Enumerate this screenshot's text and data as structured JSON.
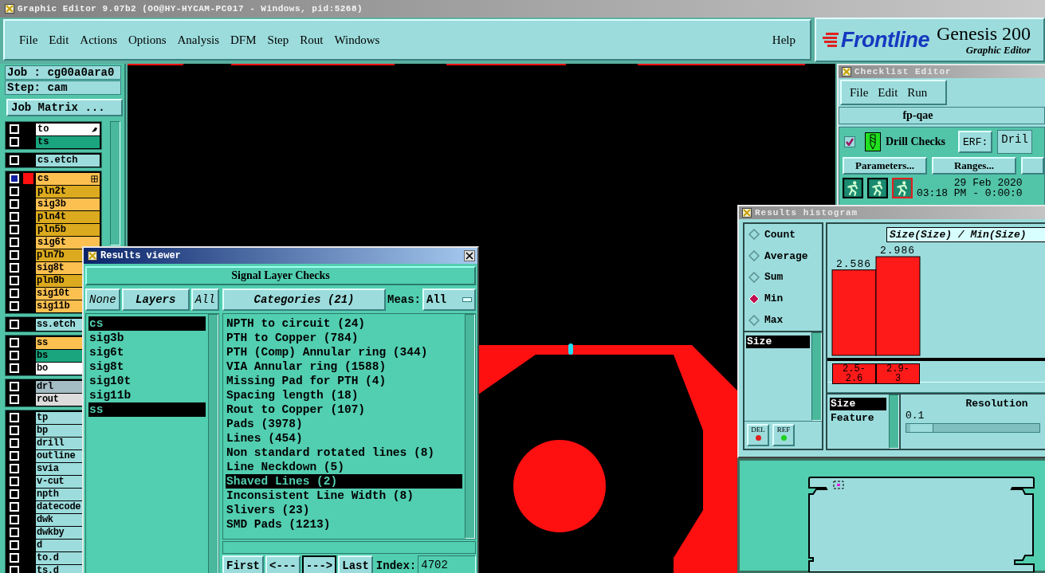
{
  "app_window": {
    "title": "Graphic Editor 9.07b2 (OO@HY-HYCAM-PC017 - Windows, pid:5268)"
  },
  "menu": [
    "File",
    "Edit",
    "Actions",
    "Options",
    "Analysis",
    "DFM",
    "Step",
    "Rout",
    "Windows"
  ],
  "help_menu": "Help",
  "logo": {
    "brand": "Frontline",
    "product": "Genesis 200",
    "subtitle": "Graphic Editor"
  },
  "job": {
    "job": "Job : cg00a0ara0",
    "step": "Step: cam",
    "matrix_button": "Job Matrix ..."
  },
  "layer_groups": [
    {
      "layers": [
        {
          "name": "to",
          "color": "#ffffff",
          "selected": false,
          "shown": false,
          "kind": "edit"
        },
        {
          "name": "ts",
          "color": "#1aa57e",
          "selected": false,
          "shown": false,
          "kind": "layer"
        }
      ]
    },
    {
      "layers": [
        {
          "name": "cs.etch",
          "color": "#9cdcdc",
          "selected": false,
          "shown": false,
          "kind": "layer"
        }
      ]
    },
    {
      "layers": [
        {
          "name": "cs",
          "color": "#fcc050",
          "selected": true,
          "shown": true,
          "kind": "active"
        },
        {
          "name": "pln2t",
          "color": "#dcaa1e",
          "selected": false,
          "shown": false,
          "kind": "layer"
        },
        {
          "name": "sig3b",
          "color": "#fcc050",
          "selected": false,
          "shown": false,
          "kind": "layer"
        },
        {
          "name": "pln4t",
          "color": "#dcaa1e",
          "selected": false,
          "shown": false,
          "kind": "layer"
        },
        {
          "name": "pln5b",
          "color": "#dcaa1e",
          "selected": false,
          "shown": false,
          "kind": "layer"
        },
        {
          "name": "sig6t",
          "color": "#fcc050",
          "selected": false,
          "shown": false,
          "kind": "layer"
        },
        {
          "name": "pln7b",
          "color": "#dcaa1e",
          "selected": false,
          "shown": false,
          "kind": "layer"
        },
        {
          "name": "sig8t",
          "color": "#fcc050",
          "selected": false,
          "shown": false,
          "kind": "layer"
        },
        {
          "name": "pln9b",
          "color": "#dcaa1e",
          "selected": false,
          "shown": false,
          "kind": "layer"
        },
        {
          "name": "sig10t",
          "color": "#fcc050",
          "selected": false,
          "shown": false,
          "kind": "layer"
        },
        {
          "name": "sig11b",
          "color": "#fcc050",
          "selected": false,
          "shown": false,
          "kind": "layer"
        }
      ]
    },
    {
      "layers": [
        {
          "name": "ss.etch",
          "color": "#9cdcdc",
          "selected": false,
          "shown": false,
          "kind": "layer"
        }
      ]
    },
    {
      "layers": [
        {
          "name": "ss",
          "color": "#fcc050",
          "selected": false,
          "shown": false,
          "kind": "layer"
        },
        {
          "name": "bs",
          "color": "#1aa57e",
          "selected": false,
          "shown": false,
          "kind": "layer"
        },
        {
          "name": "bo",
          "color": "#ffffff",
          "selected": false,
          "shown": false,
          "kind": "layer"
        }
      ]
    },
    {
      "layers": [
        {
          "name": "drl",
          "color": "#a4bcc4",
          "selected": false,
          "shown": false,
          "kind": "layer"
        },
        {
          "name": "rout",
          "color": "#dcdcdc",
          "selected": false,
          "shown": false,
          "kind": "layer"
        }
      ]
    },
    {
      "layers": [
        {
          "name": "tp",
          "color": "#9cdcdc",
          "selected": false,
          "shown": false,
          "kind": "layer"
        },
        {
          "name": "bp",
          "color": "#9cdcdc",
          "selected": false,
          "shown": false,
          "kind": "layer"
        },
        {
          "name": "drill",
          "color": "#9cdcdc",
          "selected": false,
          "shown": false,
          "kind": "layer"
        },
        {
          "name": "outline",
          "color": "#9cdcdc",
          "selected": false,
          "shown": false,
          "kind": "layer"
        },
        {
          "name": "svia",
          "color": "#9cdcdc",
          "selected": false,
          "shown": false,
          "kind": "layer"
        },
        {
          "name": "v-cut",
          "color": "#9cdcdc",
          "selected": false,
          "shown": false,
          "kind": "layer"
        },
        {
          "name": "npth",
          "color": "#9cdcdc",
          "selected": false,
          "shown": false,
          "kind": "layer"
        },
        {
          "name": "datecode",
          "color": "#9cdcdc",
          "selected": false,
          "shown": false,
          "kind": "layer"
        },
        {
          "name": "dwk",
          "color": "#9cdcdc",
          "selected": false,
          "shown": false,
          "kind": "layer"
        },
        {
          "name": "dwkby",
          "color": "#9cdcdc",
          "selected": false,
          "shown": false,
          "kind": "layer"
        },
        {
          "name": "d",
          "color": "#9cdcdc",
          "selected": false,
          "shown": false,
          "kind": "layer"
        },
        {
          "name": "to.d",
          "color": "#9cdcdc",
          "selected": false,
          "shown": false,
          "kind": "layer"
        },
        {
          "name": "ts.d",
          "color": "#9cdcdc",
          "selected": false,
          "shown": false,
          "kind": "layer"
        }
      ]
    }
  ],
  "results_viewer": {
    "title": "Results viewer",
    "heading": "Signal Layer Checks",
    "none_button": "None",
    "layers_button": "Layers",
    "all_button": "All",
    "categories_button": "Categories (21)",
    "meas_label": "Meas:",
    "meas_value": "All",
    "layers": [
      {
        "name": "cs",
        "selected": true
      },
      {
        "name": "sig3b",
        "selected": false
      },
      {
        "name": "sig6t",
        "selected": false
      },
      {
        "name": "sig8t",
        "selected": false
      },
      {
        "name": "sig10t",
        "selected": false
      },
      {
        "name": "sig11b",
        "selected": false
      },
      {
        "name": "ss",
        "selected": true
      }
    ],
    "categories": [
      {
        "label": "NPTH to circuit (24)",
        "selected": false
      },
      {
        "label": "PTH to Copper (784)",
        "selected": false
      },
      {
        "label": "PTH (Comp) Annular ring (344)",
        "selected": false
      },
      {
        "label": "VIA Annular ring (1588)",
        "selected": false
      },
      {
        "label": "Missing Pad for PTH (4)",
        "selected": false
      },
      {
        "label": "Spacing length (18)",
        "selected": false
      },
      {
        "label": "Rout to Copper (107)",
        "selected": false
      },
      {
        "label": "Pads (3978)",
        "selected": false
      },
      {
        "label": "Lines (454)",
        "selected": false
      },
      {
        "label": "Non standard rotated lines (8)",
        "selected": false
      },
      {
        "label": "Line Neckdown (5)",
        "selected": false
      },
      {
        "label": "Shaved Lines (2)",
        "selected": true
      },
      {
        "label": "Inconsistent Line Width (8)",
        "selected": false
      },
      {
        "label": "Slivers (23)",
        "selected": false
      },
      {
        "label": "SMD Pads (1213)",
        "selected": false
      }
    ],
    "nav": [
      {
        "label": "First",
        "selected": false
      },
      {
        "label": "<---",
        "selected": false
      },
      {
        "label": "--->",
        "selected": true
      },
      {
        "label": "Last",
        "selected": false
      }
    ],
    "index_label": "Index:",
    "index_value": "4702"
  },
  "checklist_editor": {
    "title": "Checklist Editor",
    "menu": [
      "File",
      "Edit",
      "Run"
    ],
    "checklist_name": "fp-qae",
    "check": {
      "checked": true,
      "name": "Drill Checks",
      "erf_label": "ERF:",
      "erf_value": "Dril"
    },
    "buttons": [
      "Parameters...",
      "Ranges..."
    ],
    "date": "29 Feb 2020",
    "time": "03:18 PM - 0:00:0"
  },
  "histogram": {
    "title": "Results histogram",
    "modes": [
      {
        "label": "Count",
        "selected": false
      },
      {
        "label": "Average",
        "selected": false
      },
      {
        "label": "Sum",
        "selected": false
      },
      {
        "label": "Min",
        "selected": true
      },
      {
        "label": "Max",
        "selected": false
      }
    ],
    "attributes": [
      {
        "label": "Size",
        "selected": true
      }
    ],
    "del_button": "DEL",
    "ref_button": "REF",
    "chart_data": {
      "type": "bar",
      "title": "Size(Size) / Min(Size)",
      "categories": [
        "2.5-2.6",
        "2.9-3"
      ],
      "values": [
        2.586,
        2.986
      ],
      "data_labels": true
    },
    "axes": [
      {
        "label": "Size",
        "selected": true
      },
      {
        "label": "Feature",
        "selected": false
      }
    ],
    "resolution_label": "Resolution",
    "resolution_value": "0.1",
    "resolution_slider": {
      "level": 0.03
    }
  }
}
